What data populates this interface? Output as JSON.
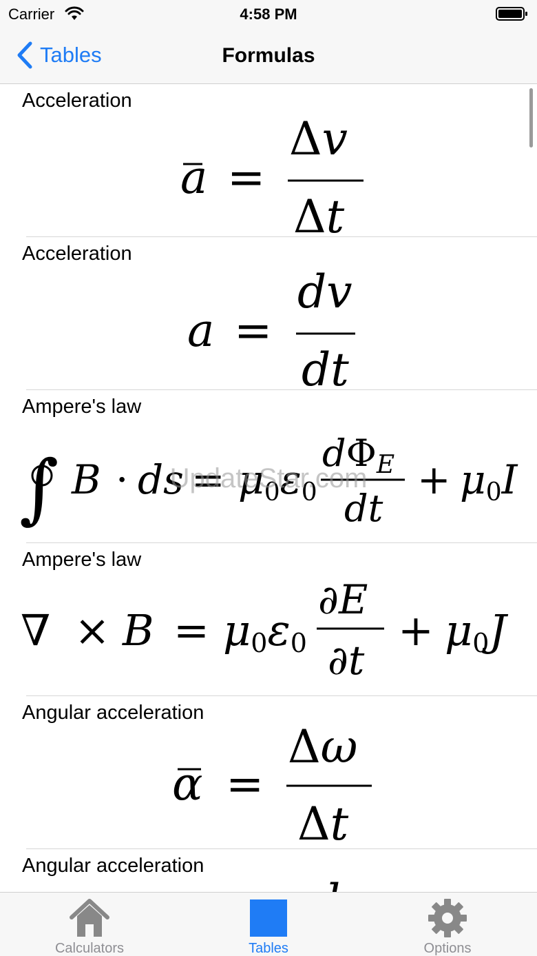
{
  "status": {
    "carrier": "Carrier",
    "time": "4:58 PM"
  },
  "nav": {
    "back_label": "Tables",
    "title": "Formulas"
  },
  "formulas": [
    {
      "label": "Acceleration"
    },
    {
      "label": "Acceleration"
    },
    {
      "label": "Ampere's law"
    },
    {
      "label": "Ampere's law"
    },
    {
      "label": "Angular acceleration"
    },
    {
      "label": "Angular acceleration"
    }
  ],
  "watermark": "UpdateStar.com",
  "tabs": [
    {
      "label": "Calculators",
      "icon": "house-icon"
    },
    {
      "label": "Tables",
      "icon": "blue-square-icon",
      "active": true
    },
    {
      "label": "Options",
      "icon": "gear-icon"
    }
  ],
  "colors": {
    "accent": "#1f7cf5",
    "inactive": "#8e8e93",
    "bar": "#f7f7f7",
    "icon_gray": "#888888"
  }
}
